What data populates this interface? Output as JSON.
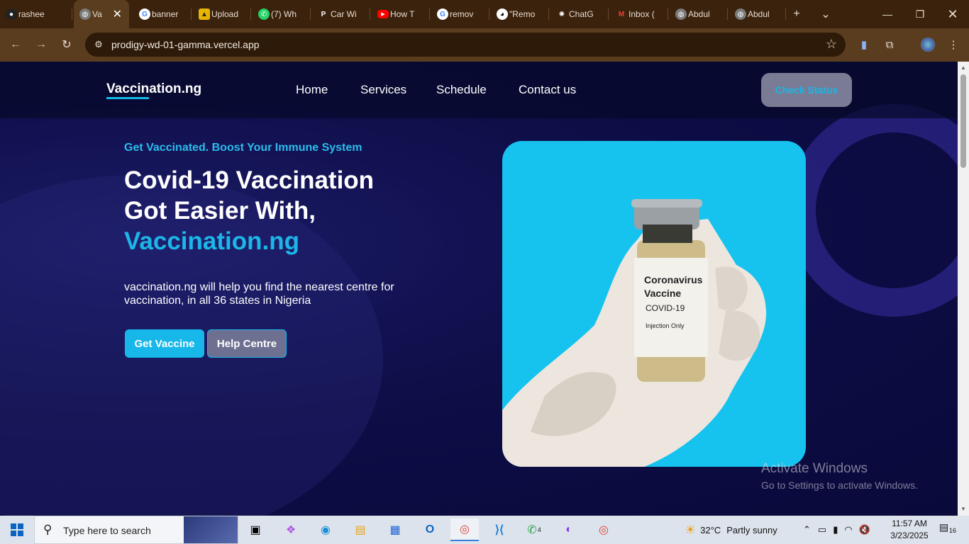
{
  "browser": {
    "tabs": [
      {
        "label": "rashee",
        "icon": "github-icon"
      },
      {
        "label": "Va",
        "icon": "globe-icon",
        "active": true
      },
      {
        "label": "banner",
        "icon": "google-icon"
      },
      {
        "label": "Upload",
        "icon": "upload-icon"
      },
      {
        "label": "(7) Wh",
        "icon": "whatsapp-icon"
      },
      {
        "label": "Car Wi",
        "icon": "p-logo-icon"
      },
      {
        "label": "How T",
        "icon": "youtube-icon"
      },
      {
        "label": "remov",
        "icon": "google-icon"
      },
      {
        "label": "\"Remo",
        "icon": "panda-icon"
      },
      {
        "label": "ChatG",
        "icon": "chatgpt-icon"
      },
      {
        "label": "Inbox (",
        "icon": "gmail-icon"
      },
      {
        "label": "Abdul",
        "icon": "globe-icon"
      },
      {
        "label": "Abdul",
        "icon": "globe-icon"
      }
    ],
    "new_tab": "+",
    "tab_search": "⌄",
    "url": "prodigy-wd-01-gamma.vercel.app"
  },
  "site": {
    "logo": "Vaccination.ng",
    "nav": [
      "Home",
      "Services",
      "Schedule",
      "Contact us"
    ],
    "check_status": "Check Status",
    "kicker": "Get Vaccinated. Boost Your Immune System",
    "headline_line1": "Covid-19 Vaccination",
    "headline_line2": "Got Easier With,",
    "headline_line3": "Vaccination.ng",
    "description": "vaccination.ng will help you find the nearest centre for vaccination, in all 36 states in Nigeria",
    "btn_get_vaccine": "Get Vaccine",
    "btn_help_centre": "Help Centre",
    "vial_label": {
      "line1": "Coronavirus",
      "line2": "Vaccine",
      "line3": "COVID-19",
      "line4": "Injection Only"
    }
  },
  "watermark": {
    "title": "Activate Windows",
    "subtitle": "Go to Settings to activate Windows."
  },
  "taskbar": {
    "search_placeholder": "Type here to search",
    "weather_temp": "32°C",
    "weather_desc": "Partly sunny",
    "time": "11:57 AM",
    "date": "3/23/2025",
    "notification_count": "16",
    "whatsapp_badge": "4"
  },
  "colors": {
    "accent": "#14b8e6",
    "page_bg": "#0e0e48",
    "browser_frame": "#3a220d"
  }
}
